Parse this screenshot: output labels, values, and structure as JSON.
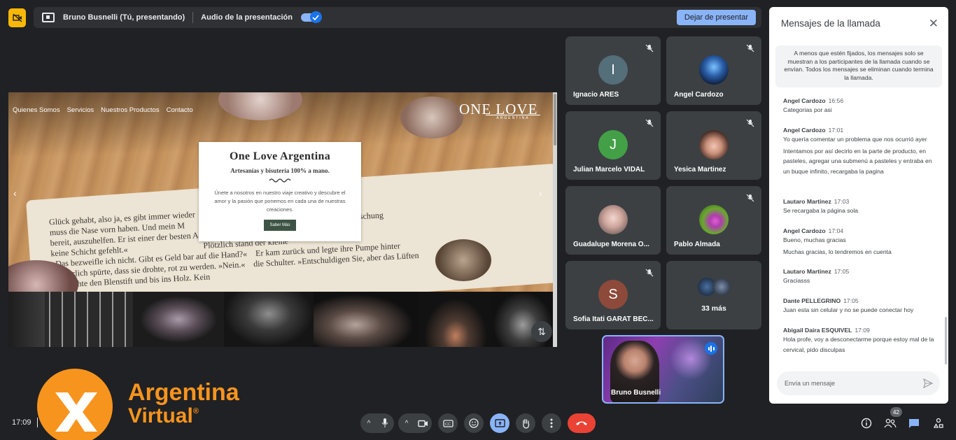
{
  "presentation_bar": {
    "presenter": "Bruno Busnelli (Tú, presentando)",
    "audio_label": "Audio de la presentación",
    "audio_enabled": true,
    "stop_button": "Dejar de presentar"
  },
  "shared_site": {
    "nav": [
      "Quienes Somos",
      "Servicios",
      "Nuestros Productos",
      "Contacto"
    ],
    "logo": "ONE LOVE",
    "logo_sub": "ARGENTINA",
    "card_title": "One Love Argentina",
    "card_subtitle": "Artesanías y bisutería 100% a mano.",
    "card_text": "Únete a nosotros en nuestro viaje creativo y descubre el amor y la pasión que ponemos en cada una de nuestras creaciones.",
    "card_button": "Saber Más",
    "book_text": "Glück gehabt, also ja, es gibt immer wieder        hätten gern ein Haus wie Ihres«\nmuss die Nase vorn haben. Und mein M                 Plötzlich das allerdings erhebliche Enttäuschung\nbereit, auszuhelfen. Er ist einer der besten Arbeiter. Hat noch    sich bringen würde.«\nkeine Schicht gefehlt.«                                    Plötzlich stand der kleine\n»Das bezweifle ich nicht. Gibt es Geld bar auf die Hand?«    Er kam zurück und legte ihre Pumpe hinter\n»Natürlich spürte, dass sie drohte, rot zu werden. »Nein.«    die Schulter. »Entschuldigen Sie, aber das Lüften\n»Er drehte den Blenstift und bis ins Holz. Kein"
  },
  "participants": [
    {
      "name": "Ignacio ARES",
      "initial": "I",
      "color": "#546e7a",
      "muted": true
    },
    {
      "name": "Angel Cardozo",
      "initial": "",
      "color": "#1c3b6e",
      "muted": true
    },
    {
      "name": "Julian Marcelo VIDAL",
      "initial": "J",
      "color": "#43a047",
      "muted": true
    },
    {
      "name": "Yesica Martinez",
      "initial": "",
      "color": "#c99a86",
      "muted": true
    },
    {
      "name": "Guadalupe Morena O...",
      "initial": "",
      "color": "#b89a93",
      "muted": false
    },
    {
      "name": "Pablo Almada",
      "initial": "",
      "color": "#6a9b2e",
      "muted": true
    },
    {
      "name": "Sofia Itati GARAT BEC...",
      "initial": "S",
      "color": "#8d4a3a",
      "muted": true
    }
  ],
  "more_tile": {
    "label": "33 más"
  },
  "self_view": {
    "name": "Bruno Busnelli"
  },
  "chat": {
    "title": "Mensajes de la llamada",
    "notice": "A menos que estén fijados, los mensajes solo se muestran a los participantes de la llamada cuando se envían. Todos los mensajes se eliminan cuando termina la llamada.",
    "messages": [
      {
        "author": "Angel Cardozo",
        "time": "16:56",
        "lines": [
          "Categorias por asi"
        ]
      },
      {
        "author": "Angel Cardozo",
        "time": "17:01",
        "lines": [
          "Yo quería comentar un problema que nos ocurrió ayer",
          "Intentamos por así decirlo en la parte de producto, en pasteles, agregar una submenú a pasteles y entraba en un buque infinito, recargaba la pagina"
        ]
      },
      {
        "author": "Lautaro Martinez",
        "time": "17:03",
        "lines": [
          "Se recargaba la página sola"
        ]
      },
      {
        "author": "Angel Cardozo",
        "time": "17:04",
        "lines": [
          "Bueno, muchas gracias",
          "Muchas gracias, lo tendremos en cuenta"
        ]
      },
      {
        "author": "Lautaro Martinez",
        "time": "17:05",
        "lines": [
          "Graciasss"
        ]
      },
      {
        "author": "Dante PELLEGRINO",
        "time": "17:05",
        "lines": [
          "Juan esta sin celular y no se puede conectar hoy"
        ]
      },
      {
        "author": "Abigail Daira ESQUIVEL",
        "time": "17:09",
        "lines": [
          "Hola profe, voy a desconectarme porque estoy mal de la cervical, pido disculpas"
        ]
      }
    ],
    "input_placeholder": "Envía un mensaje"
  },
  "bottom_bar": {
    "time": "17:09",
    "brand_line1": "Argentina",
    "brand_line2": "Virtual",
    "brand_mark": "®",
    "people_count": "42"
  },
  "colors": {
    "background": "#202124",
    "accent": "#8ab4f8",
    "brand": "#f7941e",
    "hangup": "#ea4335"
  }
}
